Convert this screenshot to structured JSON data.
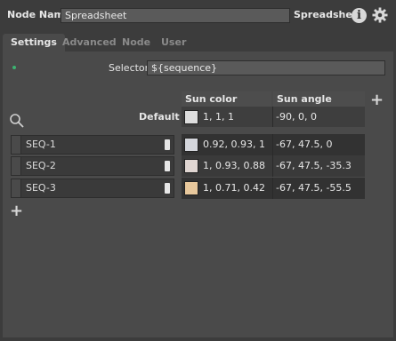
{
  "header": {
    "node_name_label": "Node Name",
    "node_name_value": "Spreadsheet",
    "node_type_label": "Spreadsheet",
    "info_icon_glyph": "i",
    "gear_icon": "gear-icon"
  },
  "tabs": [
    {
      "label": "Settings",
      "active": true
    },
    {
      "label": "Advanced",
      "active": false
    },
    {
      "label": "Node",
      "active": false
    },
    {
      "label": "User",
      "active": false
    }
  ],
  "selector": {
    "label": "Selector",
    "value": "${sequence}",
    "status_dot_color": "#3cb371"
  },
  "columns": {
    "color_header": "Sun color",
    "angle_header": "Sun angle"
  },
  "default_row": {
    "label": "Default",
    "color_value": "1, 1, 1",
    "color_swatch": "#dddddd",
    "angle_value": "-90, 0, 0"
  },
  "rows": [
    {
      "label": "SEQ-1",
      "color_value": "0.92, 0.93, 1",
      "color_swatch": "#d4d6dc",
      "angle_value": "-67, 47.5, 0"
    },
    {
      "label": "SEQ-2",
      "color_value": "1, 0.93, 0.88",
      "color_swatch": "#e0d6d2",
      "angle_value": "-67, 47.5, -35.3"
    },
    {
      "label": "SEQ-3",
      "color_value": "1, 0.71, 0.42",
      "color_swatch": "#e8c89c",
      "angle_value": "-67, 47.5, -55.5"
    }
  ],
  "icons": {
    "add": "+",
    "search": "search-icon"
  }
}
